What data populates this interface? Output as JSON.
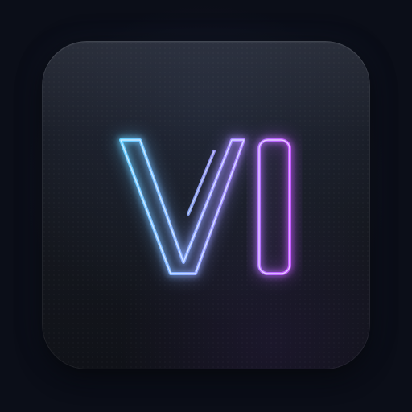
{
  "icon": {
    "name": "neon-vi-logo",
    "lettering": "VI",
    "colors": {
      "background": "#0b0e18",
      "tile_top": "#1d212c",
      "tile_bottom": "#101218",
      "neon_blue": "#5fd3ff",
      "neon_violet": "#b07cff",
      "neon_purple": "#c35cff"
    }
  }
}
